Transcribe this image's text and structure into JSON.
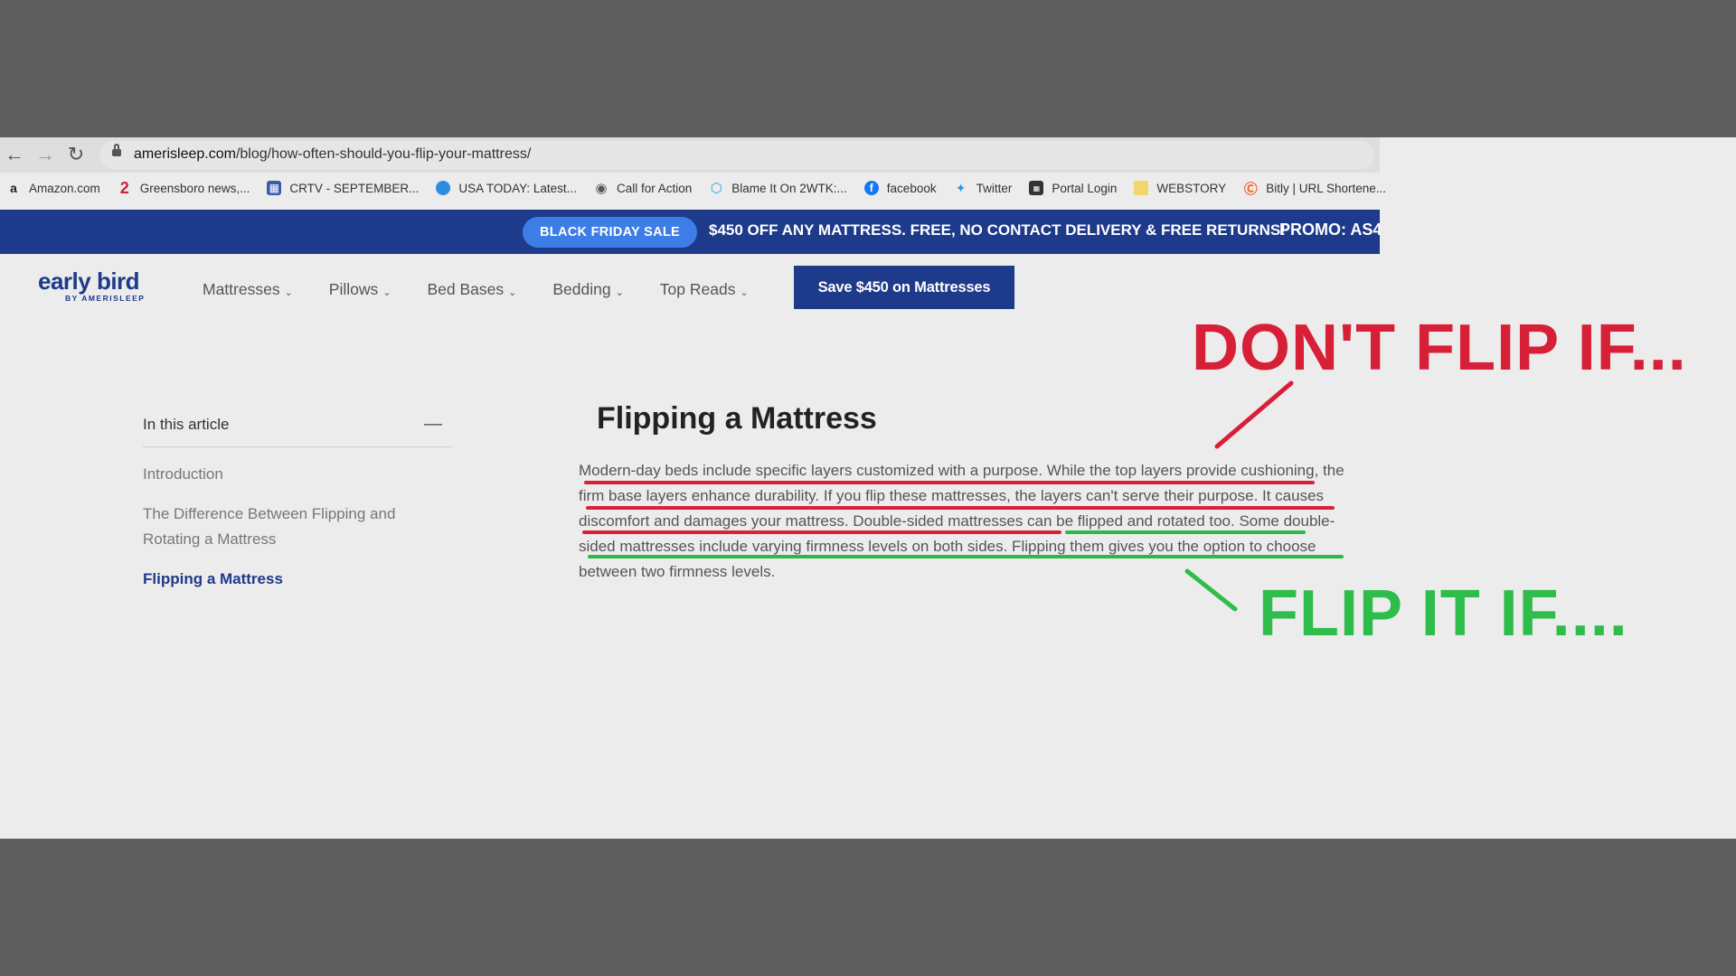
{
  "browser": {
    "url_host": "amerisleep.com",
    "url_path": "/blog/how-often-should-you-flip-your-mattress/",
    "bookmarks": [
      {
        "label": "Amazon.com",
        "icon": "amazon-icon"
      },
      {
        "label": "Greensboro news,...",
        "icon": "greensboro-icon"
      },
      {
        "label": "CRTV - SEPTEMBER...",
        "icon": "calendar-icon"
      },
      {
        "label": "USA TODAY: Latest...",
        "icon": "usatoday-icon"
      },
      {
        "label": "Call for Action",
        "icon": "globe-icon"
      },
      {
        "label": "Blame It On 2WTK:...",
        "icon": "hexagon-icon"
      },
      {
        "label": "facebook",
        "icon": "facebook-icon"
      },
      {
        "label": "Twitter",
        "icon": "twitter-icon"
      },
      {
        "label": "Portal Login",
        "icon": "portal-icon"
      },
      {
        "label": "WEBSTORY",
        "icon": "folder-icon"
      },
      {
        "label": "Bitly | URL Shortene...",
        "icon": "bitly-icon"
      }
    ]
  },
  "promo": {
    "pill": "BLACK FRIDAY SALE",
    "text": "$450 OFF ANY MATTRESS. FREE, NO CONTACT DELIVERY & FREE RETURNS!",
    "code": "PROMO: AS4"
  },
  "header": {
    "logo_main": "early bird",
    "logo_sub": "BY AMERISLEEP",
    "nav": [
      "Mattresses",
      "Pillows",
      "Bed Bases",
      "Bedding",
      "Top Reads"
    ],
    "cta": "Save $450 on Mattresses"
  },
  "toc": {
    "title": "In this article",
    "collapse": "—",
    "items": [
      "Introduction",
      "The Difference Between Flipping and Rotating a Mattress",
      "Flipping a Mattress"
    ]
  },
  "article": {
    "title": "Flipping a Mattress",
    "body": "Modern-day beds include specific layers customized with a purpose. While the top layers provide cushioning, the firm base layers enhance durability. If you flip these mattresses, the layers can't serve their purpose. It causes discomfort and damages your mattress. Double-sided mattresses can be flipped and rotated too. Some double-sided mattresses include varying firmness levels on both sides. Flipping them gives you the option to choose between two firmness levels."
  },
  "annotations": {
    "red": "DON'T FLIP IF...",
    "green": "FLIP IT IF....",
    "red_color": "#d81f38",
    "green_color": "#2ebd4a"
  },
  "colors": {
    "brand_blue": "#1e3a8a",
    "pill_blue": "#3d7de6"
  }
}
